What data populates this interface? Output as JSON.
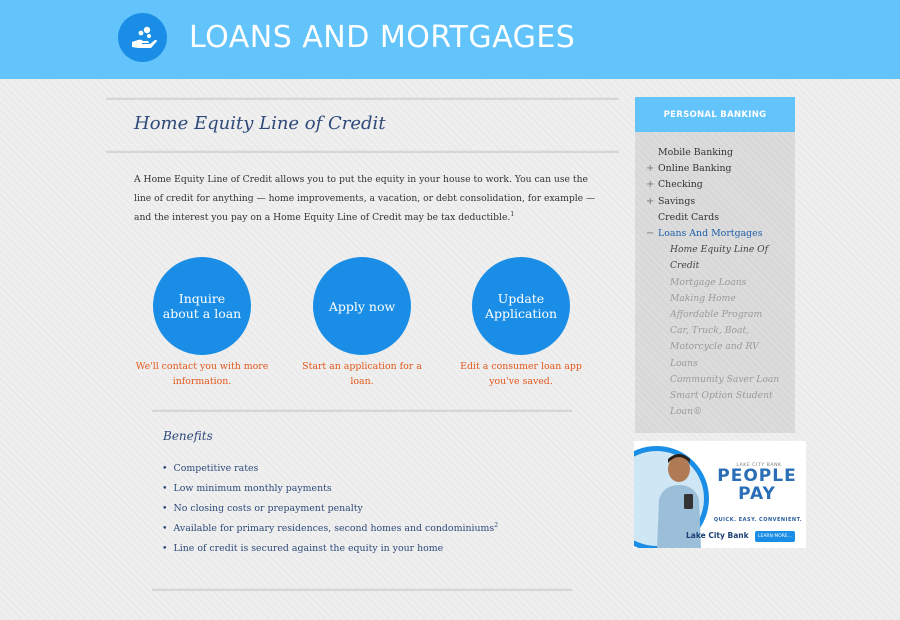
{
  "header": {
    "title": "LOANS AND MORTGAGES",
    "logo_icon": "hand-coins-icon"
  },
  "main": {
    "title": "Home Equity Line of Credit",
    "intro": "A Home Equity Line of Credit allows you to put the equity in your house to work. You can use the line of credit for anything — home improvements, a vacation, or debt consolidation, for example — and the interest you pay on a Home Equity Line of Credit may be tax deductible.",
    "intro_footnote": "1",
    "ctas": [
      {
        "label": "Inquire about a loan",
        "note": "We'll contact you with more information."
      },
      {
        "label": "Apply now",
        "note": "Start an application for a loan."
      },
      {
        "label": "Update Application",
        "note": "Edit a consumer loan app you've saved."
      }
    ],
    "benefits_title": "Benefits",
    "benefits": [
      "Competitive rates",
      "Low minimum monthly payments",
      "No closing costs or prepayment penalty",
      "Available for primary residences, second homes and condominiums",
      "Line of credit is secured against the equity in your home"
    ],
    "benefit_footnote": "2"
  },
  "sidebar": {
    "heading": "PERSONAL BANKING",
    "items": [
      {
        "label": "Mobile Banking",
        "expander": ""
      },
      {
        "label": "Online Banking",
        "expander": "+"
      },
      {
        "label": "Checking",
        "expander": "+"
      },
      {
        "label": "Savings",
        "expander": "+"
      },
      {
        "label": "Credit Cards",
        "expander": ""
      },
      {
        "label": "Loans And Mortgages",
        "expander": "−"
      }
    ],
    "subitems": [
      "Home Equity Line Of Credit",
      "Mortgage Loans",
      "Making Home Affordable Program",
      "Car, Truck, Boat, Motorcycle and RV Loans",
      "Community Saver Loan",
      "Smart Option Student Loan®"
    ]
  },
  "ad": {
    "small_text": "LAKE CITY BANK",
    "headline_1": "PEOPLE",
    "headline_2": "PAY",
    "tagline": "QUICK. EASY. CONVENIENT.",
    "brand": "Lake City Bank",
    "button": "LEARN MORE..."
  },
  "colors": {
    "header": "#62c4fb",
    "cta": "#1a8ee6",
    "cta_note": "#e2581b",
    "title": "#2e4a7a"
  }
}
